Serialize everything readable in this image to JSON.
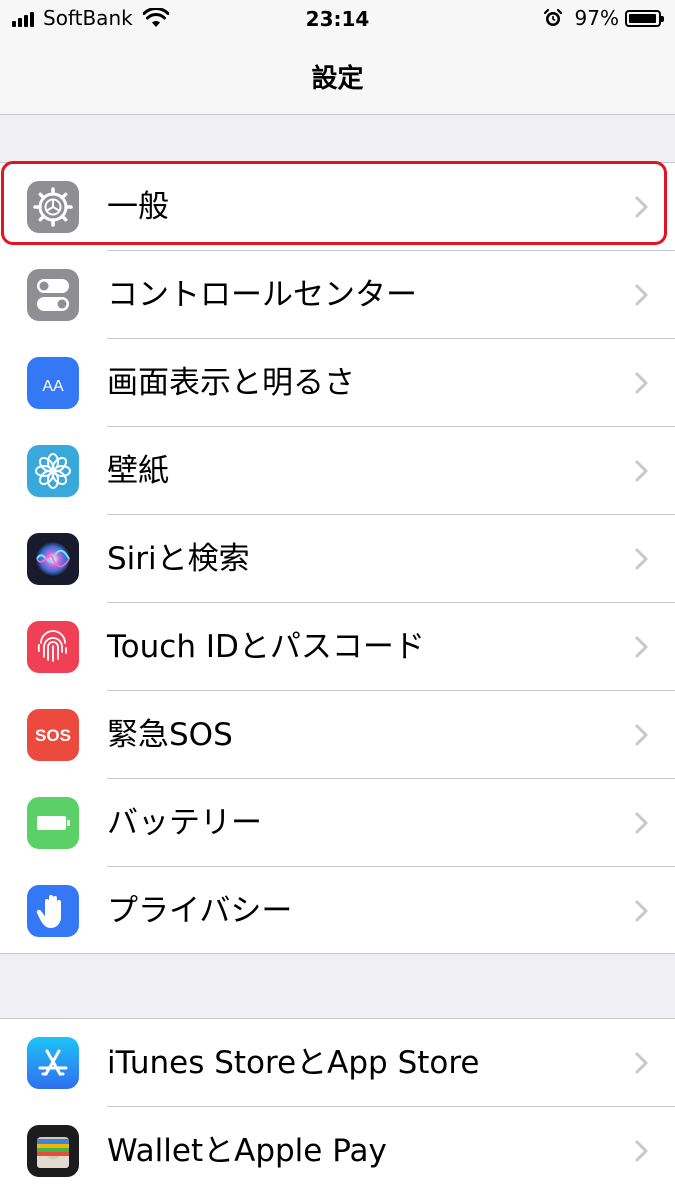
{
  "status_bar": {
    "carrier": "SoftBank",
    "time": "23:14",
    "battery_percent": "97%",
    "battery_level": 0.97
  },
  "nav": {
    "title": "設定"
  },
  "groups": [
    {
      "rows": [
        {
          "label": "一般",
          "icon": "gear-icon",
          "color": "#8e8e93",
          "highlighted": true
        },
        {
          "label": "コントロールセンター",
          "icon": "toggles-icon",
          "color": "#8e8e93"
        },
        {
          "label": "画面表示と明るさ",
          "icon": "display-text-icon",
          "color": "#3478f6"
        },
        {
          "label": "壁紙",
          "icon": "flower-icon",
          "color": "#39a8db"
        },
        {
          "label": "Siriと検索",
          "icon": "siri-icon",
          "color": "#1a1a2e"
        },
        {
          "label": "Touch IDとパスコード",
          "icon": "fingerprint-icon",
          "color": "#ef4056"
        },
        {
          "label": "緊急SOS",
          "icon": "sos-icon",
          "color": "#ec4a3e"
        },
        {
          "label": "バッテリー",
          "icon": "battery-icon",
          "color": "#5bd067"
        },
        {
          "label": "プライバシー",
          "icon": "hand-icon",
          "color": "#3478f6"
        }
      ]
    },
    {
      "rows": [
        {
          "label": "iTunes StoreとApp Store",
          "icon": "app-store-icon",
          "color": "#2d8cf0"
        },
        {
          "label": "WalletとApple Pay",
          "icon": "wallet-icon",
          "color": "#1c1c1e"
        }
      ]
    }
  ],
  "sos_icon_text": "SOS",
  "display_icon_text": "AA",
  "colors": {
    "highlight": "#e3131f",
    "chevron": "#c7c7cc",
    "background": "#efeff4"
  }
}
